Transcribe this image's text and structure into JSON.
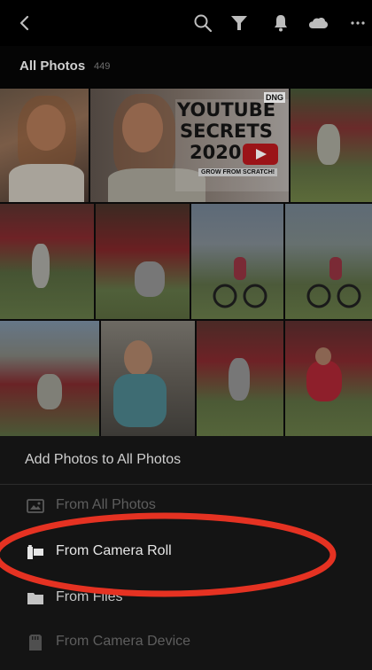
{
  "header": {
    "icons": [
      "back-chevron-icon",
      "search-icon",
      "filter-icon",
      "bell-icon",
      "cloud-icon",
      "more-icon"
    ]
  },
  "album": {
    "title": "All Photos",
    "count": "449"
  },
  "thumbnail_overlay": {
    "youtube_text_1": "YOUTUBE",
    "youtube_text_2": "SECRETS",
    "youtube_year": "2020",
    "youtube_tagline": "GROW FROM SCRATCH!",
    "dng_badge": "DNG"
  },
  "add_sheet": {
    "title": "Add Photos to All Photos",
    "options": [
      {
        "label": "From All Photos",
        "icon": "image-icon",
        "enabled": false
      },
      {
        "label": "From Camera Roll",
        "icon": "camera-roll-icon",
        "enabled": true
      },
      {
        "label": "From Files",
        "icon": "folder-icon",
        "enabled": true
      },
      {
        "label": "From Camera Device",
        "icon": "sd-card-icon",
        "enabled": false
      }
    ]
  },
  "colors": {
    "annotation_circle": "#e53222",
    "accent_red": "#d9191f"
  }
}
